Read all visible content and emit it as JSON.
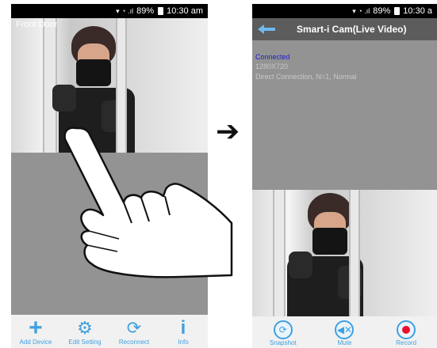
{
  "left_screen": {
    "status_bar": {
      "battery": "89%",
      "time": "10:30 am"
    },
    "camera_title": "Front Door",
    "toolbar": [
      {
        "label": "Add Device",
        "icon": "plus-icon"
      },
      {
        "label": "Edit Setting",
        "icon": "gear-icon"
      },
      {
        "label": "Reconnect",
        "icon": "refresh-icon"
      },
      {
        "label": "Info",
        "icon": "info-icon"
      }
    ]
  },
  "right_screen": {
    "status_bar": {
      "battery": "89%",
      "time": "10:30 a"
    },
    "title": "Smart-i Cam(Live Video)",
    "status": {
      "connection": "Connected",
      "resolution": "1280X720",
      "details": "Direct Connection, N=1, Normal"
    },
    "toolbar": [
      {
        "label": "Snapshot",
        "icon": "camera-icon"
      },
      {
        "label": "Mute",
        "icon": "speaker-muted-icon"
      },
      {
        "label": "Record",
        "icon": "record-icon"
      }
    ]
  },
  "colors": {
    "accent": "#3fa0e0",
    "connected_text": "#1b1bd8",
    "record": "#e8112d",
    "header_bg": "#5c5c5c",
    "panel_bg": "#939393"
  }
}
